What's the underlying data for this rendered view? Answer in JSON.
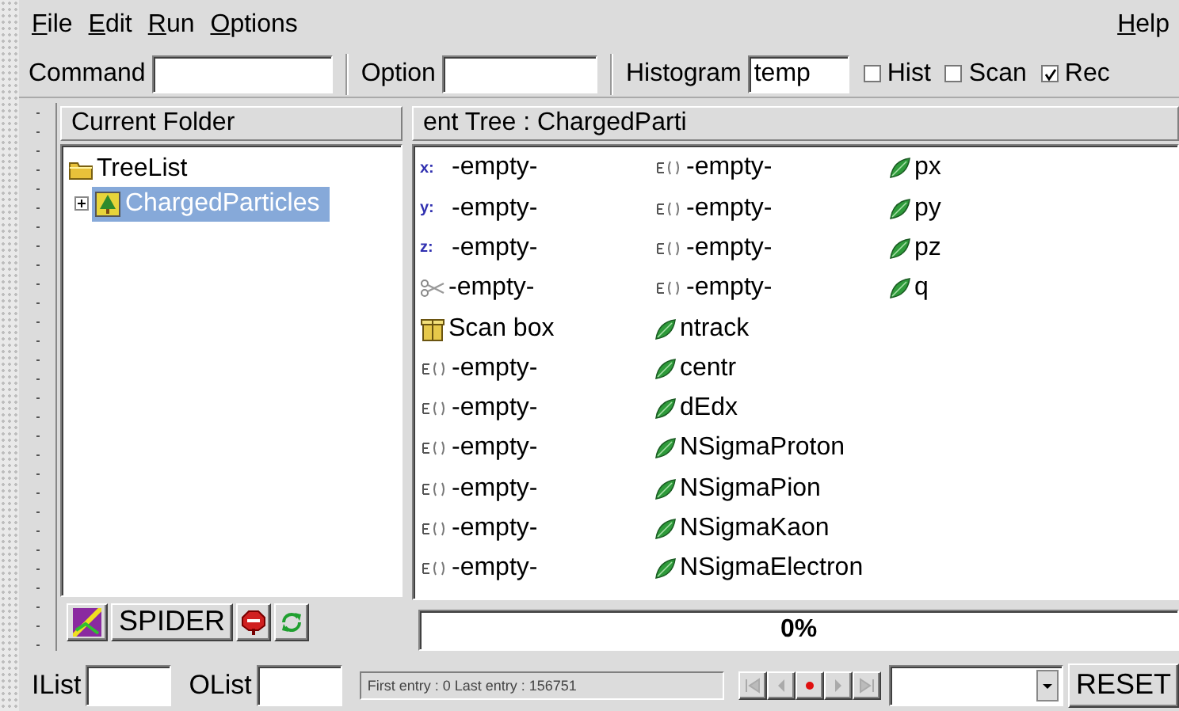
{
  "menu": {
    "items": [
      "File",
      "Edit",
      "Run",
      "Options"
    ],
    "help": "Help"
  },
  "toolbar": {
    "command_label": "Command",
    "option_label": "Option",
    "histogram_label": "Histogram",
    "histogram_value": "temp",
    "checkboxes": [
      {
        "label": "Hist",
        "checked": false
      },
      {
        "label": "Scan",
        "checked": false
      },
      {
        "label": "Rec",
        "checked": true
      }
    ]
  },
  "folder_panel": {
    "title": "Current Folder",
    "tree": [
      {
        "label": "TreeList",
        "kind": "folder",
        "selected": false,
        "children": [
          {
            "label": "ChargedParticles",
            "kind": "tree",
            "selected": true,
            "expanded": false
          }
        ]
      }
    ],
    "spider_button": "SPIDER"
  },
  "tree_panel": {
    "title": "ent Tree : ChargedParti",
    "columns": [
      [
        {
          "kind": "axis",
          "badge": "x:",
          "label": "-empty-"
        },
        {
          "kind": "axis",
          "badge": "y:",
          "label": "-empty-"
        },
        {
          "kind": "axis",
          "badge": "z:",
          "label": "-empty-"
        },
        {
          "kind": "cut",
          "label": "-empty-"
        },
        {
          "kind": "scanbox",
          "label": "Scan box"
        },
        {
          "kind": "expression",
          "label": "-empty-"
        },
        {
          "kind": "expression",
          "label": "-empty-"
        },
        {
          "kind": "expression",
          "label": "-empty-"
        },
        {
          "kind": "expression",
          "label": "-empty-"
        },
        {
          "kind": "expression",
          "label": "-empty-"
        },
        {
          "kind": "expression",
          "label": "-empty-"
        }
      ],
      [
        {
          "kind": "expression",
          "label": "-empty-"
        },
        {
          "kind": "expression",
          "label": "-empty-"
        },
        {
          "kind": "expression",
          "label": "-empty-"
        },
        {
          "kind": "expression",
          "label": "-empty-"
        },
        {
          "kind": "leaf",
          "label": "ntrack"
        },
        {
          "kind": "leaf",
          "label": "centr"
        },
        {
          "kind": "leaf",
          "label": "dEdx"
        },
        {
          "kind": "leaf",
          "label": "NSigmaProton"
        },
        {
          "kind": "leaf",
          "label": "NSigmaPion"
        },
        {
          "kind": "leaf",
          "label": "NSigmaKaon"
        },
        {
          "kind": "leaf",
          "label": "NSigmaElectron"
        }
      ],
      [
        {
          "kind": "leaf",
          "label": "px"
        },
        {
          "kind": "leaf",
          "label": "py"
        },
        {
          "kind": "leaf",
          "label": "pz"
        },
        {
          "kind": "leaf",
          "label": "q"
        }
      ]
    ],
    "progress": {
      "level": 0,
      "reading": "0%"
    }
  },
  "bottom_bar": {
    "ilist_label": "IList",
    "olist_label": "OList",
    "status": "First entry : 0 Last entry : 156751",
    "reset_button": "RESET"
  }
}
